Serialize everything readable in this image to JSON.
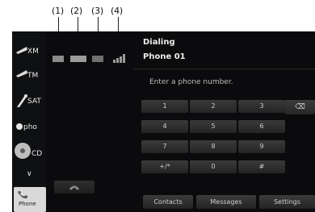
{
  "callouts": [
    "(1)",
    "(2)",
    "(3)",
    "(4)"
  ],
  "header": {
    "title": "Dialing",
    "subtitle": "Phone 01"
  },
  "prompt": "Enter a phone number.",
  "keypad": {
    "rows": [
      [
        "1",
        "2",
        "3"
      ],
      [
        "4",
        "5",
        "6"
      ],
      [
        "7",
        "8",
        "9"
      ],
      [
        "+/*",
        "0",
        "#"
      ]
    ],
    "backspace_glyph": "⌫"
  },
  "bottom_buttons": [
    "Contacts",
    "Messages",
    "Settings"
  ],
  "rail": {
    "items": [
      {
        "label": "XM"
      },
      {
        "label": "TM"
      },
      {
        "label": "SAT"
      },
      {
        "label": "pho"
      },
      {
        "label": "CD"
      },
      {
        "label": "∨"
      },
      {
        "label": "Phone"
      }
    ]
  },
  "colors": {
    "screen_bg": "#0b0b0d",
    "key": "#2c2c2c",
    "text": "#ececec"
  }
}
